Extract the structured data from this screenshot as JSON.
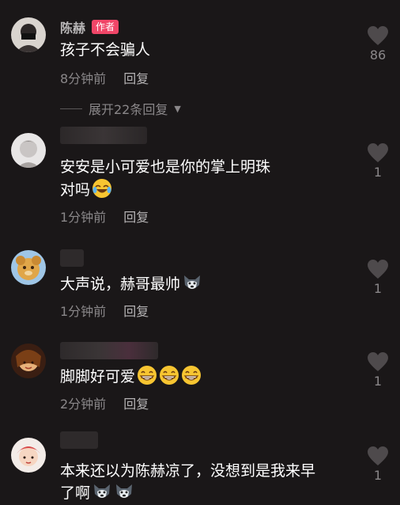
{
  "comments": [
    {
      "author": "陈赫",
      "badge": "作者",
      "text": "孩子不会骗人",
      "time": "8分钟前",
      "reply": "回复",
      "likes": "86"
    },
    {
      "text_line1": "安安是小可爱也是你的掌上明珠",
      "text_line2": "对吗",
      "time": "1分钟前",
      "reply": "回复",
      "likes": "1"
    },
    {
      "text": "大声说，赫哥最帅",
      "time": "1分钟前",
      "reply": "回复",
      "likes": "1"
    },
    {
      "text": "脚脚好可爱",
      "time": "2分钟前",
      "reply": "回复",
      "likes": "1"
    },
    {
      "text_line1": "本来还以为陈赫凉了，没想到是我来早",
      "text_line2": "了啊",
      "likes": "1"
    }
  ],
  "expand_replies": "展开22条回复",
  "colors": {
    "background": "#1a1718",
    "badge": "#f04668",
    "muted": "#8a8789"
  }
}
